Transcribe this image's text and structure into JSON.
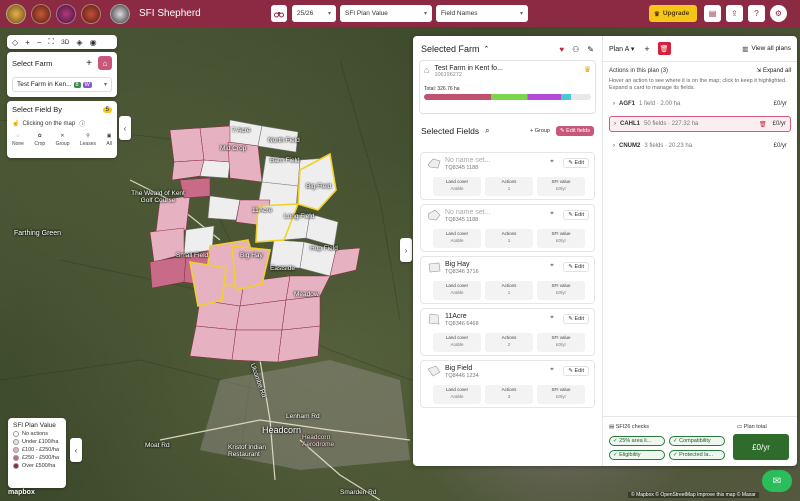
{
  "app": {
    "title": "SFI Shepherd"
  },
  "toolbar": {
    "year": "25/26",
    "metric": "SFI Plan Value",
    "labels": "Field Names",
    "upgrade": "Upgrade"
  },
  "map_controls": {
    "view_3d": "3D"
  },
  "select_farm": {
    "title": "Select Farm",
    "farm": "Test Farm in Ken...",
    "badge_a": "8",
    "badge_b": "W"
  },
  "select_field_by": {
    "title": "Select Field By",
    "count": "5",
    "subtitle": "Clicking on the map",
    "modes": [
      "None",
      "Crop",
      "Group",
      "Leases",
      "All"
    ]
  },
  "map_labels": {
    "town": "Headcorn",
    "place1": "Farthing Green",
    "place2": "The Weald of Kent Golf Course",
    "place3": "Kristof Indian Restaurant",
    "place4": "Headcorn Aerodrome",
    "road1": "Moat Rd",
    "road2": "Smarden Rd",
    "road3": "Lenham Rd",
    "road4": "Ulcombe Rd",
    "fields": [
      "7 Acre",
      "Mid Crop",
      "North Field",
      "Big Field",
      "Barn Field",
      "Long Field",
      "Big Hay",
      "Eastside",
      "11Acre",
      "Hop Field",
      "Small Field",
      "Meadow"
    ]
  },
  "legend": {
    "title": "SFI Plan Value",
    "items": [
      "No actions",
      "Under £100/ha",
      "£100 - £250/ha",
      "£250 - £500/ha",
      "Over £500/ha"
    ],
    "colors": [
      "#ffffff",
      "#f3dde4",
      "#e6b1c1",
      "#c76b88",
      "#8c2a44"
    ]
  },
  "selected_farm": {
    "title": "Selected Farm",
    "farm_name": "Test Farm in Kent fo...",
    "farm_id": "106196272",
    "total_label": "Total: 326.76 ha"
  },
  "selected_fields": {
    "title": "Selected Fields",
    "group_btn": "+ Group",
    "edit_btn": "Edit fields",
    "stat_labels": [
      "Land cover",
      "Actions",
      "SFI value"
    ],
    "edit_label": "Edit",
    "fields": [
      {
        "name": "No name set...",
        "code": "TQ8345 1188",
        "land_cover": "Arable",
        "actions": "1",
        "sfi_value": "£0/yr",
        "named": false
      },
      {
        "name": "No name set...",
        "code": "TQ8345 1188",
        "land_cover": "Arable",
        "actions": "1",
        "sfi_value": "£0/yr",
        "named": false
      },
      {
        "name": "Big Hay",
        "code": "TQ8346 3716",
        "land_cover": "Arable",
        "actions": "1",
        "sfi_value": "£0/yr",
        "named": true
      },
      {
        "name": "11Acre",
        "code": "TQ8346 6468",
        "land_cover": "Arable",
        "actions": "2",
        "sfi_value": "£0/yr",
        "named": true
      },
      {
        "name": "Big Field",
        "code": "TQ8446 1234",
        "land_cover": "Arable",
        "actions": "3",
        "sfi_value": "£0/yr",
        "named": true
      }
    ]
  },
  "plan": {
    "name": "Plan A",
    "view_all": "View all plans",
    "actions_title": "Actions in this plan (3)",
    "expand_all": "Expand all",
    "hint": "Hover an action to see where it is on the map; click to keep it highlighted. Expand a card to manage its fields.",
    "actions": [
      {
        "code": "AGF1",
        "detail": "1 field · 2.00 ha",
        "price": "£0/yr"
      },
      {
        "code": "CAHL1",
        "detail": "50 fields · 227.32 ha",
        "price": "£0/yr"
      },
      {
        "code": "CNUM2",
        "detail": "3 fields · 20.23 ha",
        "price": "£0/yr"
      }
    ],
    "checks_title": "SFI26 checks",
    "checks": [
      "25% area li...",
      "Compatibility",
      "Eligibility",
      "Protected la..."
    ],
    "total_label": "Plan total",
    "total_value": "£0/yr"
  },
  "attribution": {
    "logo": "mapbox",
    "text": "© Mapbox © OpenStreetMap Improve this map © Maxar"
  }
}
